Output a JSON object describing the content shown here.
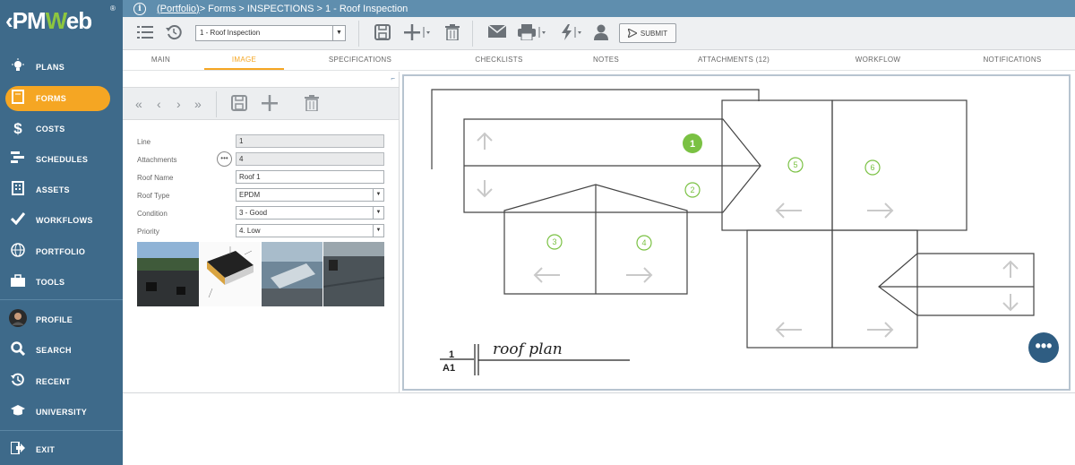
{
  "logo": {
    "text_main": "PM",
    "text_w": "W",
    "text_end": "eb",
    "reg": "®",
    "back": "‹"
  },
  "breadcrumb": {
    "link": "(Portfolio)",
    "rest": " > Forms > INSPECTIONS > 1 - Roof Inspection"
  },
  "nav": [
    {
      "label": "PLANS",
      "icon": "lightbulb-icon"
    },
    {
      "label": "FORMS",
      "icon": "document-icon",
      "active": true
    },
    {
      "label": "COSTS",
      "icon": "dollar-icon"
    },
    {
      "label": "SCHEDULES",
      "icon": "gantt-icon"
    },
    {
      "label": "ASSETS",
      "icon": "building-icon"
    },
    {
      "label": "WORKFLOWS",
      "icon": "checkmark-icon"
    },
    {
      "label": "PORTFOLIO",
      "icon": "globe-icon"
    },
    {
      "label": "TOOLS",
      "icon": "toolbox-icon"
    },
    {
      "label": "PROFILE",
      "icon": "avatar-icon"
    },
    {
      "label": "SEARCH",
      "icon": "search-icon"
    },
    {
      "label": "RECENT",
      "icon": "history-icon"
    },
    {
      "label": "UNIVERSITY",
      "icon": "graduation-cap-icon"
    },
    {
      "label": "EXIT",
      "icon": "exit-icon"
    }
  ],
  "toolbar": {
    "record_value": "1 - Roof Inspection",
    "submit_label": "SUBMIT"
  },
  "tabs": [
    "MAIN",
    "IMAGE",
    "SPECIFICATIONS",
    "CHECKLISTS",
    "NOTES",
    "ATTACHMENTS (12)",
    "WORKFLOW",
    "NOTIFICATIONS"
  ],
  "form": {
    "line_label": "Line",
    "line_value": "1",
    "attachments_label": "Attachments",
    "attachments_value": "4",
    "attach_btn": "•••",
    "roof_name_label": "Roof Name",
    "roof_name_value": "Roof 1",
    "roof_type_label": "Roof Type",
    "roof_type_value": "EPDM",
    "condition_label": "Condition",
    "condition_value": "3 - Good",
    "priority_label": "Priority",
    "priority_value": "4. Low"
  },
  "drawing": {
    "sections": [
      "1",
      "2",
      "3",
      "4",
      "5",
      "6"
    ],
    "detail_number": "1",
    "detail_sheet": "A1",
    "title": "roof plan"
  },
  "colors": {
    "sidebar": "#3e6a8a",
    "accent": "#f5a623",
    "section_green": "#7ac143",
    "more_button": "#2f5d82"
  }
}
